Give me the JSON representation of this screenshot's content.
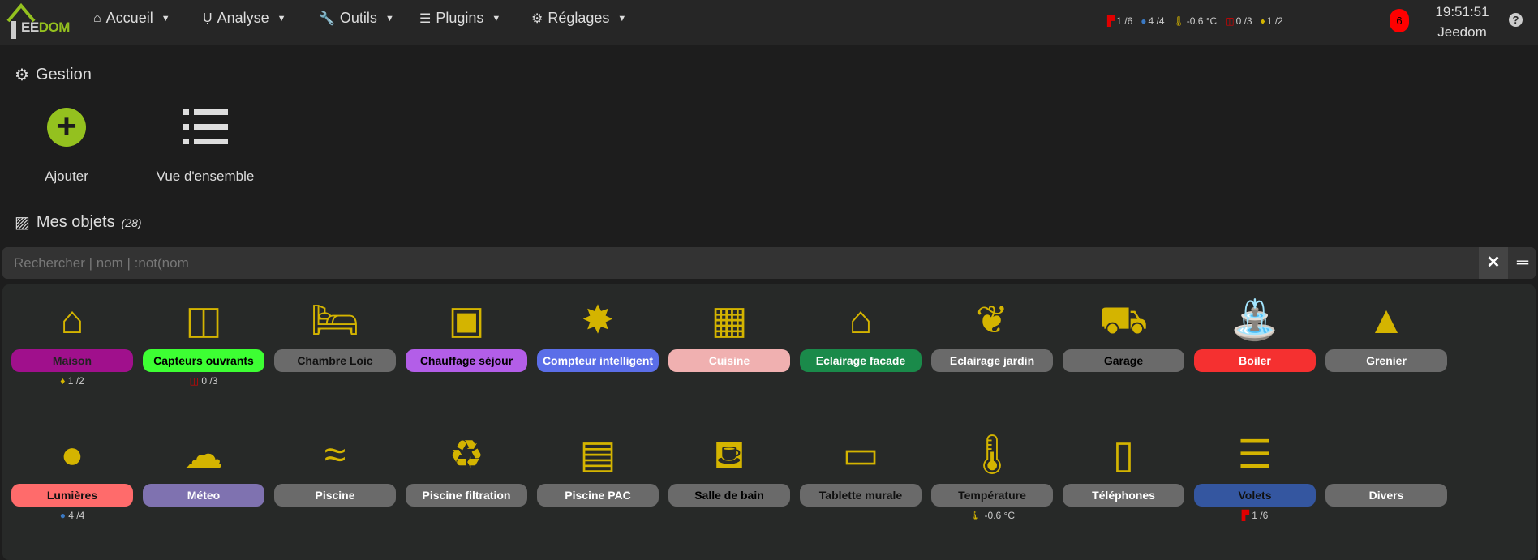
{
  "logo": {
    "text_a": "J",
    "text_b": "EE",
    "text_c": "DOM"
  },
  "nav": [
    {
      "label": "Accueil",
      "icon": "home-icon",
      "glyph": "⌂"
    },
    {
      "label": "Analyse",
      "icon": "stethoscope-icon",
      "glyph": "Ụ"
    },
    {
      "label": "Outils",
      "icon": "wrench-icon",
      "glyph": "🔧"
    },
    {
      "label": "Plugins",
      "icon": "list-check-icon",
      "glyph": "☰"
    },
    {
      "label": "Réglages",
      "icon": "gear-icon",
      "glyph": "⚙"
    }
  ],
  "status": [
    {
      "icon": "shutter-icon",
      "glyph": "▛",
      "color": "#e00000",
      "text": "1 /6"
    },
    {
      "icon": "lightbulb-icon",
      "glyph": "●",
      "color": "#3a79c4",
      "text": "4 /4"
    },
    {
      "icon": "thermometer-icon",
      "glyph": "🌡",
      "color": "#d4b400",
      "text": "-0.6 °C"
    },
    {
      "icon": "window-icon",
      "glyph": "◫",
      "color": "#e00000",
      "text": "0 /3"
    },
    {
      "icon": "flame-icon",
      "glyph": "♦",
      "color": "#d4b400",
      "text": "1 /2"
    }
  ],
  "notifications": "6",
  "clock": {
    "time": "19:51:51",
    "name": "Jeedom"
  },
  "help": "?",
  "gestion": {
    "title": "Gestion",
    "add": "Ajouter",
    "overview": "Vue d'ensemble"
  },
  "objects": {
    "title": "Mes objets",
    "count": "(28)"
  },
  "search": {
    "placeholder": "Rechercher | nom | :not(nom",
    "clear": "✕",
    "toggle": "═"
  },
  "tiles": [
    {
      "name": "Maison",
      "icon": "house-user-icon",
      "glyph": "⌂",
      "bg": "#a0108c",
      "fg": "#222",
      "sum": "1 /2",
      "sumIcon": "flame-icon",
      "sumGlyph": "♦",
      "sumColor": "#d4b400"
    },
    {
      "name": "Capteurs ouvrants",
      "icon": "window-icon",
      "glyph": "◫",
      "bg": "#3dff33",
      "fg": "#000",
      "sum": "0 /3",
      "sumIcon": "window-icon",
      "sumGlyph": "◫",
      "sumColor": "#e00000"
    },
    {
      "name": "Chambre Loic",
      "icon": "bed-icon",
      "glyph": "🛏",
      "bg": "#6a6a6a",
      "fg": "#111"
    },
    {
      "name": "Chauffage séjour",
      "icon": "double-bed-icon",
      "glyph": "▣",
      "bg": "#b35ee8",
      "fg": "#000"
    },
    {
      "name": "Compteur intelligent",
      "icon": "burst-icon",
      "glyph": "✸",
      "bg": "#5b6ee8",
      "fg": "#fff"
    },
    {
      "name": "Cuisine",
      "icon": "kitchen-icon",
      "glyph": "▦",
      "bg": "#f0b0b0",
      "fg": "#fff"
    },
    {
      "name": "Eclairage facade",
      "icon": "house-light-icon",
      "glyph": "⌂",
      "bg": "#1a8a4a",
      "fg": "#fff"
    },
    {
      "name": "Eclairage jardin",
      "icon": "seedling-icon",
      "glyph": "❦",
      "bg": "#6a6a6a",
      "fg": "#fff"
    },
    {
      "name": "Garage",
      "icon": "garage-icon",
      "glyph": "⛟",
      "bg": "#6a6a6a",
      "fg": "#000"
    },
    {
      "name": "Boiler",
      "icon": "shower-icon",
      "glyph": "⛲",
      "bg": "#f53030",
      "fg": "#fff"
    },
    {
      "name": "Grenier",
      "icon": "tent-icon",
      "glyph": "▲",
      "bg": "#6a6a6a",
      "fg": "#fff"
    },
    {
      "name": "Lumières",
      "icon": "lightbulb-icon",
      "glyph": "●",
      "bg": "#ff6b6b",
      "fg": "#111",
      "sum": "4 /4",
      "sumIcon": "lightbulb-icon",
      "sumGlyph": "●",
      "sumColor": "#3a79c4"
    },
    {
      "name": "Méteo",
      "icon": "cloud-sun-icon",
      "glyph": "☁",
      "bg": "#7f72b0",
      "fg": "#fff"
    },
    {
      "name": "Piscine",
      "icon": "swimmer-icon",
      "glyph": "≈",
      "bg": "#6a6a6a",
      "fg": "#fff"
    },
    {
      "name": "Piscine filtration",
      "icon": "recycle-icon",
      "glyph": "♻",
      "bg": "#6a6a6a",
      "fg": "#fff"
    },
    {
      "name": "Piscine PAC",
      "icon": "list-alt-icon",
      "glyph": "▤",
      "bg": "#6a6a6a",
      "fg": "#fff"
    },
    {
      "name": "Salle de bain",
      "icon": "bath-icon",
      "glyph": "⛾",
      "bg": "#6a6a6a",
      "fg": "#000"
    },
    {
      "name": "Tablette murale",
      "icon": "desktop-icon",
      "glyph": "▭",
      "bg": "#6a6a6a",
      "fg": "#111"
    },
    {
      "name": "Température",
      "icon": "thermometer-icon",
      "glyph": "🌡",
      "bg": "#6a6a6a",
      "fg": "#111",
      "sum": "-0.6 °C",
      "sumIcon": "thermometer-icon",
      "sumGlyph": "🌡",
      "sumColor": "#d4b400"
    },
    {
      "name": "Téléphones",
      "icon": "mobile-icon",
      "glyph": "▯",
      "bg": "#6a6a6a",
      "fg": "#fff"
    },
    {
      "name": "Volets",
      "icon": "shutter-bars-icon",
      "glyph": "☰",
      "bg": "#3456a0",
      "fg": "#111",
      "sum": "1 /6",
      "sumIcon": "shutter-icon",
      "sumGlyph": "▛",
      "sumColor": "#e00000"
    },
    {
      "name": "Divers",
      "icon": "none",
      "glyph": "",
      "bg": "#6a6a6a",
      "fg": "#fff"
    }
  ]
}
